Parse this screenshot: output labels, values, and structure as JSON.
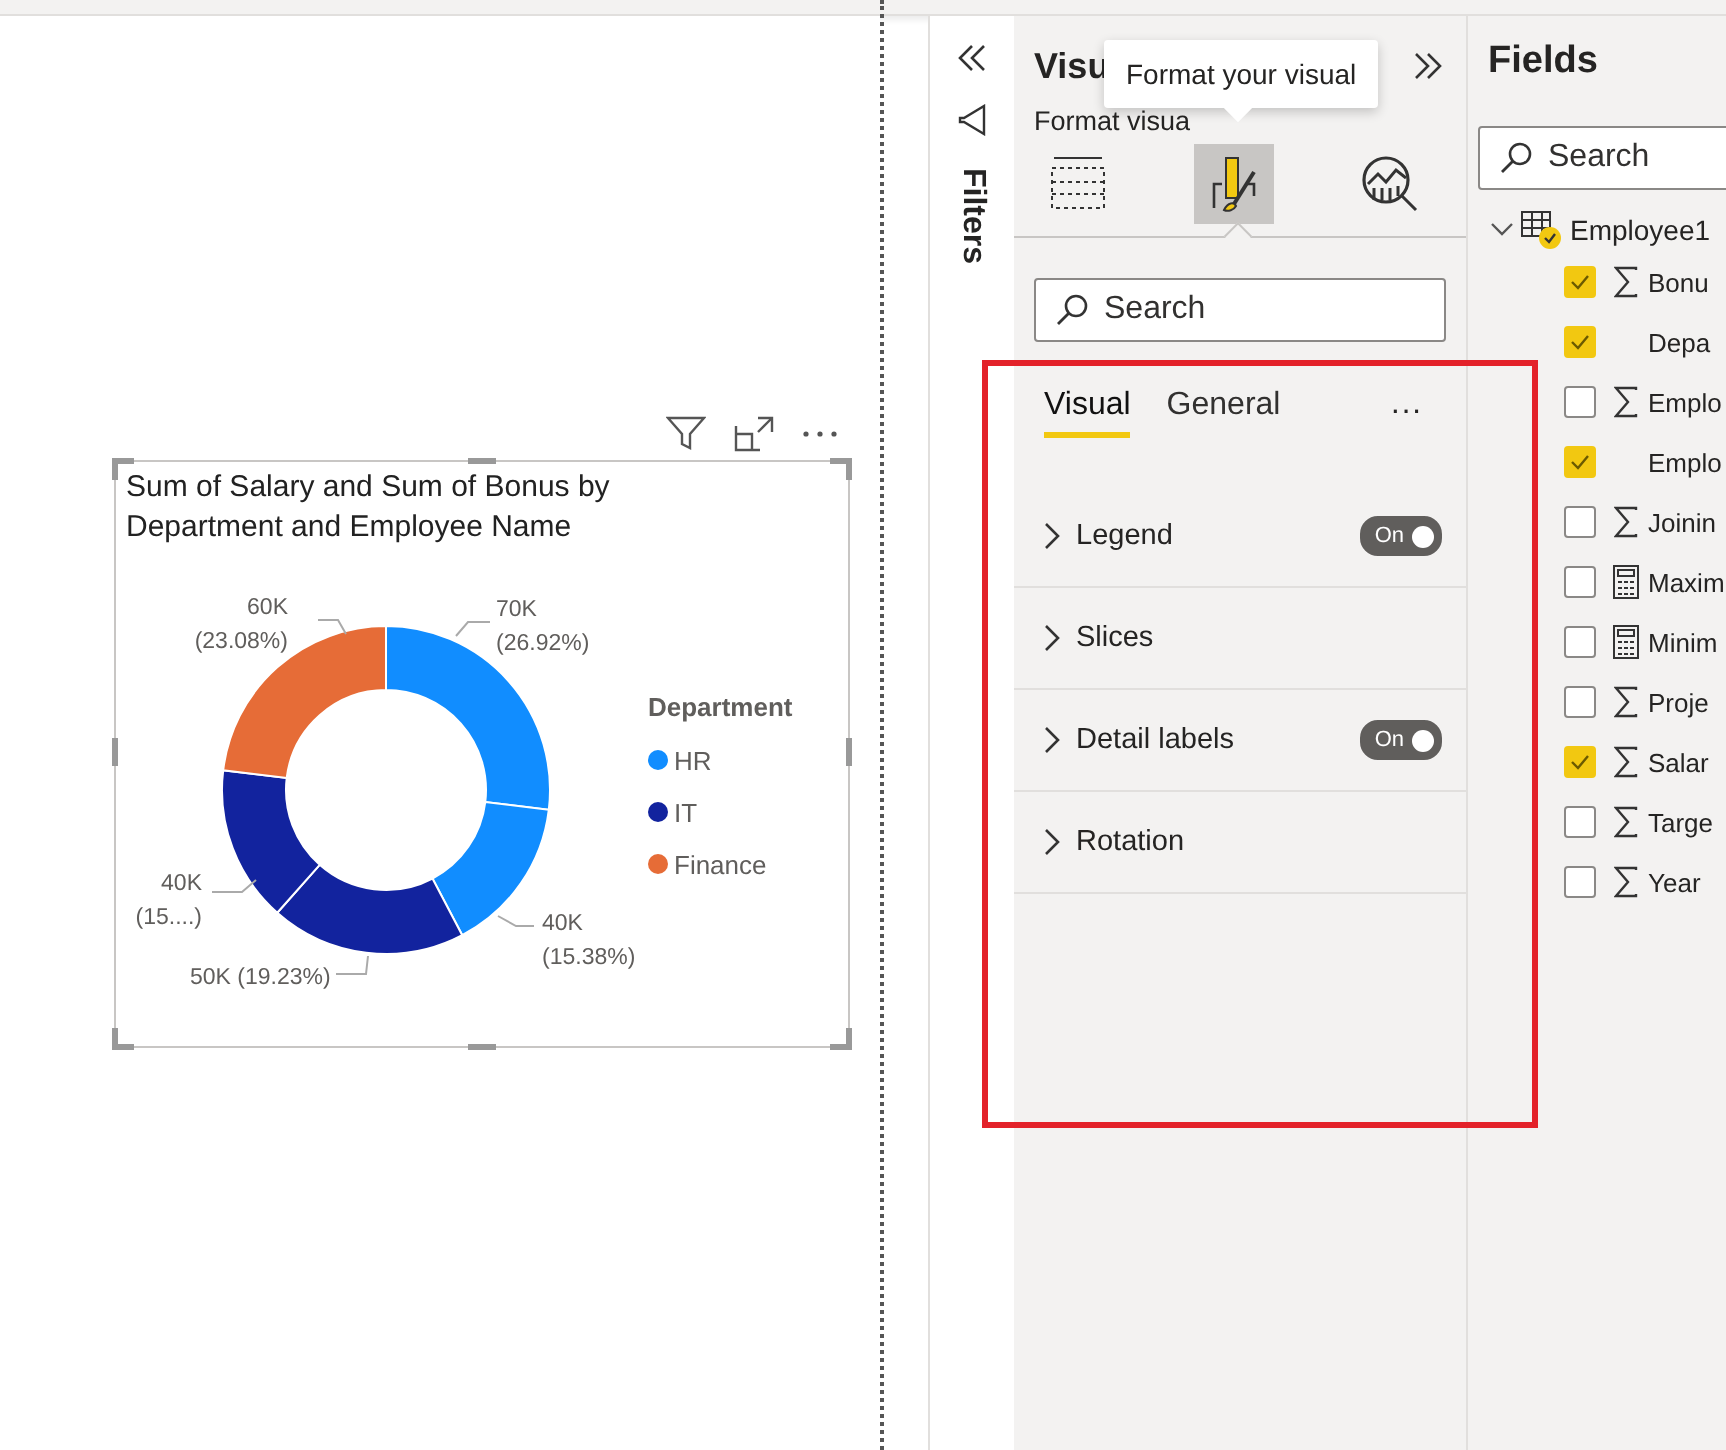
{
  "visual": {
    "title": "Sum of Salary and Sum of Bonus by Department and Employee Name",
    "legend": {
      "title": "Department",
      "items": [
        {
          "label": "HR",
          "color": "#118dff"
        },
        {
          "label": "IT",
          "color": "#12239e"
        },
        {
          "label": "Finance",
          "color": "#e66c37"
        }
      ]
    },
    "chart_data": {
      "type": "donut",
      "values": [
        26.92,
        15.38,
        19.23,
        15.38,
        23.08
      ],
      "colors": [
        "#118dff",
        "#118dff",
        "#12239e",
        "#12239e",
        "#e66c37"
      ],
      "value_labels": [
        [
          "70K",
          "(26.92%)"
        ],
        [
          "40K",
          "(15.38%)"
        ],
        [
          "50K (19.23%)"
        ],
        [
          "40K",
          "(15....)"
        ],
        [
          "60K",
          "(23.08%)"
        ]
      ]
    }
  },
  "filters_pane": {
    "label": "Filters"
  },
  "visualizations_pane": {
    "title": "Visu",
    "subtitle": "Format visua",
    "tooltip": "Format your visual",
    "icons": [
      {
        "kind": "build",
        "selected": false
      },
      {
        "kind": "format",
        "selected": true
      },
      {
        "kind": "analytics",
        "selected": false
      }
    ],
    "search": {
      "placeholder": "Search"
    },
    "tabs": [
      {
        "label": "Visual",
        "selected": true
      },
      {
        "label": "General",
        "selected": false
      }
    ],
    "more": "···",
    "sections": [
      {
        "label": "Legend",
        "toggle": "On",
        "on": true
      },
      {
        "label": "Slices"
      },
      {
        "label": "Detail labels",
        "toggle": "On",
        "on": true
      },
      {
        "label": "Rotation"
      }
    ]
  },
  "fields_pane": {
    "title": "Fields",
    "search": {
      "placeholder": "Search"
    },
    "table": {
      "name": "Employee1",
      "expanded": true,
      "checked": true,
      "fields": [
        {
          "name": "Bonu",
          "kind": "sum",
          "checked": true
        },
        {
          "name": "Depa",
          "kind": "text",
          "checked": true
        },
        {
          "name": "Emplo",
          "kind": "sum",
          "checked": false
        },
        {
          "name": "Emplo",
          "kind": "text",
          "checked": true
        },
        {
          "name": "Joinin",
          "kind": "sum",
          "checked": false
        },
        {
          "name": "Maxim",
          "kind": "measure",
          "checked": false
        },
        {
          "name": "Minim",
          "kind": "measure",
          "checked": false
        },
        {
          "name": "Proje",
          "kind": "sum",
          "checked": false
        },
        {
          "name": "Salar",
          "kind": "sum",
          "checked": true
        },
        {
          "name": "Targe",
          "kind": "sum",
          "checked": false
        },
        {
          "name": "Year",
          "kind": "sum",
          "checked": false
        }
      ]
    }
  }
}
